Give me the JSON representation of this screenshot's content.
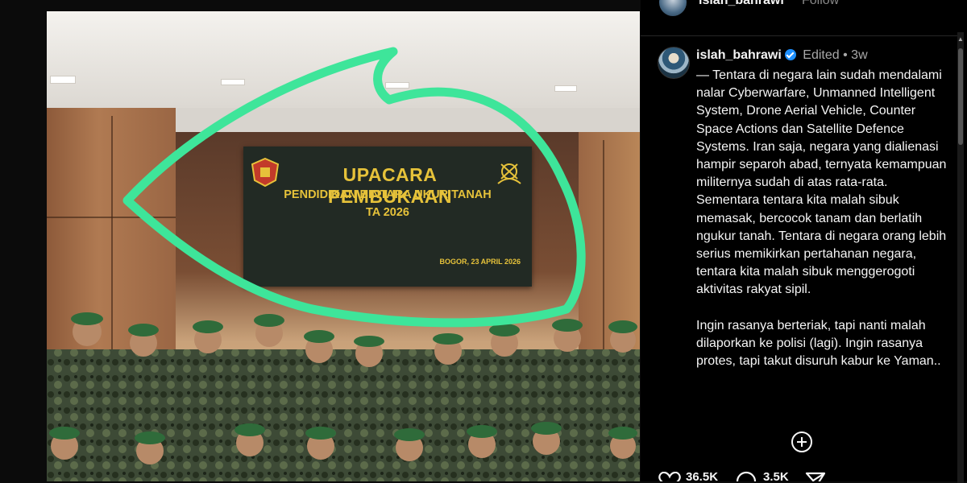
{
  "post": {
    "banner": {
      "title": "UPACARA PEMBUKAAN",
      "subtitle_line1": "PENDIDIKAN BINTARA UKUR TANAH",
      "subtitle_line2": "TA 2026",
      "date": "BOGOR, 23 APRIL 2026"
    },
    "overlay_color": "#3ee59a"
  },
  "header": {
    "username": "islah_bahrawi",
    "follow_label": "Follow"
  },
  "comment": {
    "username": "islah_bahrawi",
    "edited_label": "Edited",
    "separator": "•",
    "time": "3w",
    "caption": "— Tentara di negara lain sudah mendalami nalar Cyberwarfare, Unmanned Intelligent System, Drone Aerial Vehicle, Counter Space Actions dan Satellite Defence Systems. Iran saja, negara yang dialienasi hampir separoh abad, ternyata kemampuan militernya sudah di atas rata-rata. Sementara tentara kita malah sibuk memasak, bercocok tanam dan berlatih ngukur tanah. Tentara di negara orang lebih serius memikirkan pertahanan negara, tentara kita malah sibuk menggerogoti aktivitas rakyat sipil.\n\nIngin rasanya berteriak, tapi nanti malah dilaporkan ke polisi (lagi). Ingin rasanya protes, tapi takut disuruh kabur ke Yaman.."
  },
  "actions": {
    "likes": "36.5K",
    "comments": "3.5K"
  },
  "colors": {
    "verified": "#1e90ff",
    "banner_text": "#e6c23a",
    "panel_bg": "#000000"
  }
}
